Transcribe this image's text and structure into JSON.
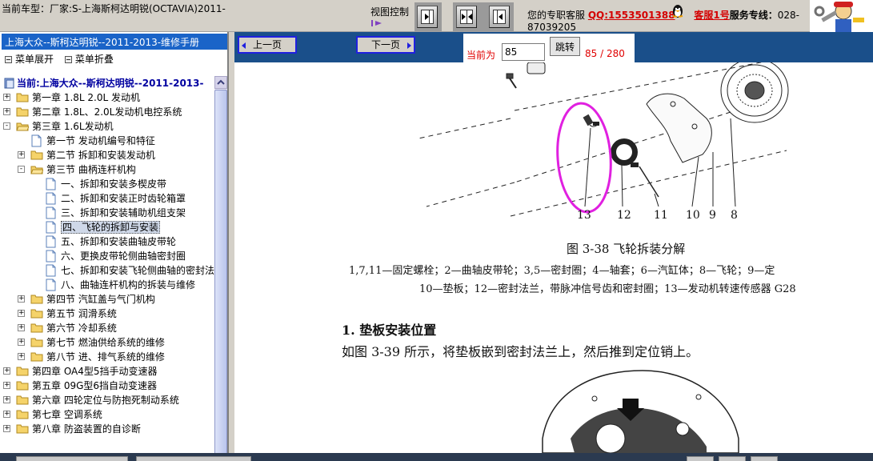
{
  "topbar": {
    "car_model": "当前车型：厂家:S-上海斯柯达明锐(OCTAVIA)2011-",
    "view_control_label": "视图控制",
    "service_prefix": "您的专职客服",
    "qq": "QQ:1553501388",
    "kefu": "客服1号",
    "hotline_label": "服务专线：",
    "hotline_head": "028-",
    "hotline_tail": "87039205"
  },
  "sidebar": {
    "header": "上海大众--斯柯达明锐--2011-2013-维修手册",
    "expand_label": "菜单展开",
    "collapse_label": "菜单折叠",
    "tree": [
      {
        "label": "当前:上海大众--斯柯达明锐--2011-2013-",
        "level": 0,
        "kind": "root"
      },
      {
        "label": "第一章 1.8L 2.0L 发动机",
        "level": 0,
        "kind": "folder",
        "exp": "+"
      },
      {
        "label": "第二章 1.8L、2.0L发动机电控系统",
        "level": 0,
        "kind": "folder",
        "exp": "+"
      },
      {
        "label": "第三章 1.6L发动机",
        "level": 0,
        "kind": "folder-open",
        "exp": "-"
      },
      {
        "label": "第一节 发动机编号和特征",
        "level": 1,
        "kind": "page"
      },
      {
        "label": "第二节 拆卸和安装发动机",
        "level": 1,
        "kind": "folder",
        "exp": "+"
      },
      {
        "label": "第三节 曲柄连杆机构",
        "level": 1,
        "kind": "folder-open",
        "exp": "-"
      },
      {
        "label": "一、拆卸和安装多楔皮带",
        "level": 2,
        "kind": "page"
      },
      {
        "label": "二、拆卸和安装正时齿轮箱罩",
        "level": 2,
        "kind": "page"
      },
      {
        "label": "三、拆卸和安装辅助机组支架",
        "level": 2,
        "kind": "page"
      },
      {
        "label": "四、飞轮的拆卸与安装",
        "level": 2,
        "kind": "page",
        "selected": true
      },
      {
        "label": "五、拆卸和安装曲轴皮带轮",
        "level": 2,
        "kind": "page"
      },
      {
        "label": "六、更换皮带轮侧曲轴密封圈",
        "level": 2,
        "kind": "page"
      },
      {
        "label": "七、拆卸和安装飞轮侧曲轴的密封法",
        "level": 2,
        "kind": "page"
      },
      {
        "label": "八、曲轴连杆机构的拆装与维修",
        "level": 2,
        "kind": "page"
      },
      {
        "label": "第四节 汽缸盖与气门机构",
        "level": 1,
        "kind": "folder",
        "exp": "+"
      },
      {
        "label": "第五节 润滑系统",
        "level": 1,
        "kind": "folder",
        "exp": "+"
      },
      {
        "label": "第六节 冷却系统",
        "level": 1,
        "kind": "folder",
        "exp": "+"
      },
      {
        "label": "第七节 燃油供给系统的维修",
        "level": 1,
        "kind": "folder",
        "exp": "+"
      },
      {
        "label": "第八节 进、排气系统的维修",
        "level": 1,
        "kind": "folder",
        "exp": "+"
      },
      {
        "label": "第四章 OA4型5挡手动变速器",
        "level": 0,
        "kind": "folder",
        "exp": "+"
      },
      {
        "label": "第五章 09G型6挡自动变速器",
        "level": 0,
        "kind": "folder",
        "exp": "+"
      },
      {
        "label": "第六章 四轮定位与防抱死制动系统",
        "level": 0,
        "kind": "folder",
        "exp": "+"
      },
      {
        "label": "第七章 空调系统",
        "level": 0,
        "kind": "folder",
        "exp": "+"
      },
      {
        "label": "第八章 防盗装置的自诊断",
        "level": 0,
        "kind": "folder",
        "exp": "+"
      }
    ]
  },
  "nav": {
    "prev_label": "上一页",
    "next_label": "下一页",
    "current_label": "当前为",
    "page_value": "85",
    "jump_label": "跳转",
    "page_count": "85 / 280"
  },
  "document": {
    "callouts": [
      "13",
      "12",
      "11",
      "10",
      "9",
      "8"
    ],
    "figure_caption": "图 3-38   飞轮拆装分解",
    "legend_line1": "1,7,11—固定螺栓；2—曲轴皮带轮；3,5—密封圈；4—轴套；6—汽缸体；8—飞轮；9—定",
    "legend_line2": "10—垫板；12—密封法兰，带脉冲信号齿和密封圈；13—发动机转速传感器 G28",
    "section_title": "1. 垫板安装位置",
    "paragraph": "如图 3-39 所示，将垫板嵌到密封法兰上，然后推到定位销上。"
  },
  "colors": {
    "sidebar_header": "#1a64c8",
    "nav_strip": "#1a4f8a",
    "accent_red": "#e00000",
    "highlight_ellipse": "#e020e0"
  }
}
